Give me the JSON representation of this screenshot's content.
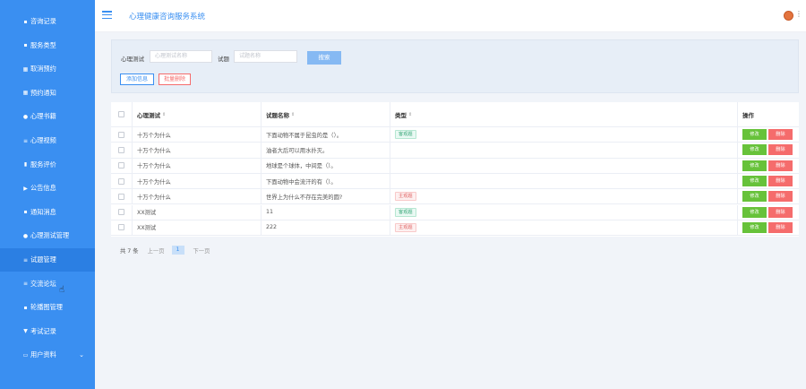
{
  "app": {
    "title": "心理健康咨询服务系统"
  },
  "sidebar": {
    "items": [
      {
        "label": "咨询记录",
        "icon": "chat-icon",
        "glyph": "▪"
      },
      {
        "label": "服务类型",
        "icon": "lock-icon",
        "glyph": "▪"
      },
      {
        "label": "取消预约",
        "icon": "grid-icon",
        "glyph": "▦"
      },
      {
        "label": "预约通知",
        "icon": "grid-icon",
        "glyph": "▦"
      },
      {
        "label": "心理书籍",
        "icon": "user-icon",
        "glyph": "●"
      },
      {
        "label": "心理视频",
        "icon": "list-icon",
        "glyph": "≡"
      },
      {
        "label": "服务评价",
        "icon": "bar-chart-icon",
        "glyph": "▮"
      },
      {
        "label": "公告信息",
        "icon": "flag-icon",
        "glyph": "▶"
      },
      {
        "label": "通知消息",
        "icon": "lock-icon",
        "glyph": "▪"
      },
      {
        "label": "心理测试管理",
        "icon": "pin-icon",
        "glyph": "●"
      },
      {
        "label": "试题管理",
        "icon": "doc-icon",
        "glyph": "≡"
      },
      {
        "label": "交流论坛",
        "icon": "doc-icon",
        "glyph": "≡"
      },
      {
        "label": "轮播图管理",
        "icon": "image-icon",
        "glyph": "▪"
      },
      {
        "label": "考试记录",
        "icon": "filter-icon",
        "glyph": "▼"
      },
      {
        "label": "用户资料",
        "icon": "folder-icon",
        "glyph": "▭"
      }
    ]
  },
  "filter": {
    "test_label": "心理测试",
    "test_placeholder": "心理测试名称",
    "question_label": "试题",
    "question_placeholder": "试题名称",
    "search_label": "搜索",
    "add_label": "添加信息",
    "batch_delete_label": "批量删除"
  },
  "table": {
    "headers": {
      "test": "心理测试",
      "name": "试题名称",
      "type": "类型",
      "op": "操作"
    },
    "rows": [
      {
        "test": "十万个为什么",
        "name": "下面动物不属于昆虫的是（）。",
        "type": "客观题",
        "type_color": "blue"
      },
      {
        "test": "十万个为什么",
        "name": "油者大后可以用水扑灭。",
        "type": "",
        "type_color": ""
      },
      {
        "test": "十万个为什么",
        "name": "地球是个球体，中间是（）。",
        "type": "",
        "type_color": ""
      },
      {
        "test": "十万个为什么",
        "name": "下面动物中会流汗的有（）。",
        "type": "",
        "type_color": ""
      },
      {
        "test": "十万个为什么",
        "name": "世界上为什么不存在完美的圆?",
        "type": "主观题",
        "type_color": "red"
      },
      {
        "test": "XX测试",
        "name": "11",
        "type": "客观题",
        "type_color": "blue"
      },
      {
        "test": "XX测试",
        "name": "222",
        "type": "主观题",
        "type_color": "red"
      }
    ],
    "edit_label": "修改",
    "delete_label": "删除"
  },
  "pager": {
    "total": "共 7 条",
    "prev": "上一页",
    "current": "1",
    "next": "下一页"
  },
  "colors": {
    "primary": "#3a8ff1",
    "success": "#67c23a",
    "danger": "#f56c6c"
  }
}
